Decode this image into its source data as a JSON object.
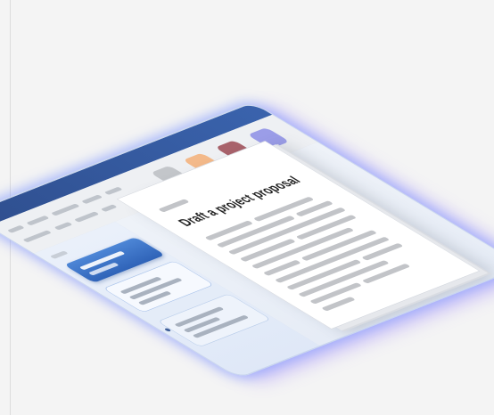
{
  "document": {
    "title": "Draft a project proposal"
  },
  "theme": {
    "titlebar_color": "#34589d",
    "swatches": [
      {
        "name": "gray-swatch",
        "color": "#c3c6ca"
      },
      {
        "name": "orange-swatch",
        "color": "#f3b98a"
      },
      {
        "name": "red-swatch",
        "color": "#a8626b"
      },
      {
        "name": "purple-swatch",
        "color": "#9b9de8"
      }
    ],
    "selected_item_color": "#3d74c8"
  }
}
